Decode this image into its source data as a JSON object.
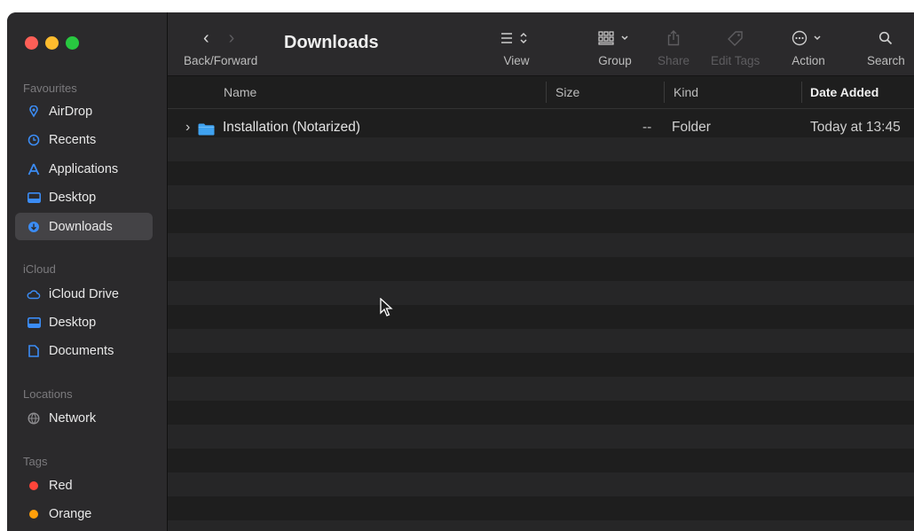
{
  "window": {
    "title": "Downloads"
  },
  "sidebar": {
    "sections": {
      "favourites": "Favourites",
      "icloud": "iCloud",
      "locations": "Locations",
      "tags": "Tags"
    },
    "favourites": [
      {
        "label": "AirDrop",
        "icon": "airdrop-icon"
      },
      {
        "label": "Recents",
        "icon": "clock-icon"
      },
      {
        "label": "Applications",
        "icon": "applications-icon"
      },
      {
        "label": "Desktop",
        "icon": "desktop-icon"
      },
      {
        "label": "Downloads",
        "icon": "download-icon",
        "selected": true
      }
    ],
    "icloud": [
      {
        "label": "iCloud Drive",
        "icon": "cloud-icon"
      },
      {
        "label": "Desktop",
        "icon": "desktop-icon"
      },
      {
        "label": "Documents",
        "icon": "document-icon"
      }
    ],
    "locations": [
      {
        "label": "Network",
        "icon": "network-icon"
      }
    ],
    "tags": [
      {
        "label": "Red",
        "color": "#ff453a"
      },
      {
        "label": "Orange",
        "color": "#ff9f0a"
      }
    ]
  },
  "toolbar": {
    "back_forward_label": "Back/Forward",
    "view_label": "View",
    "group_label": "Group",
    "share_label": "Share",
    "edit_tags_label": "Edit Tags",
    "action_label": "Action",
    "search_label": "Search"
  },
  "columns": {
    "name": "Name",
    "size": "Size",
    "kind": "Kind",
    "date_added": "Date Added"
  },
  "files": [
    {
      "name": "Installation (Notarized)",
      "size": "--",
      "kind": "Folder",
      "date_added": "Today at 13:45"
    }
  ],
  "colors": {
    "accent": "#3b8cf5",
    "folder": "#3fa2f0",
    "traffic_close": "#fe5f57",
    "traffic_min": "#febc2e",
    "traffic_max": "#28c840"
  }
}
